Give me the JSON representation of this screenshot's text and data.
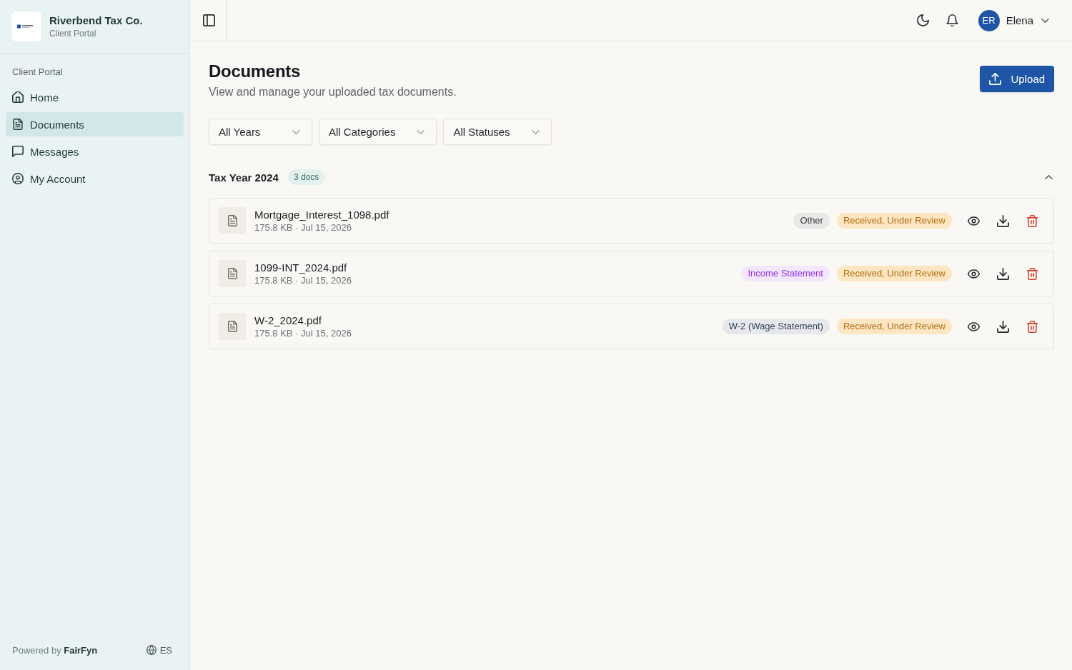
{
  "sidebar": {
    "brand": {
      "name": "Riverbend Tax Co.",
      "subtitle": "Client Portal"
    },
    "section_label": "Client Portal",
    "items": [
      {
        "label": "Home",
        "selected": false
      },
      {
        "label": "Documents",
        "selected": true
      },
      {
        "label": "Messages",
        "selected": false
      },
      {
        "label": "My Account",
        "selected": false
      }
    ],
    "footer": {
      "powered_by": "Powered by **FairFyn**",
      "language": "ES"
    }
  },
  "top_bar": {
    "user": {
      "initials": "ER",
      "name": "Elena"
    }
  },
  "page": {
    "title": "Documents",
    "subtitle": "View and manage your uploaded tax documents.",
    "upload_button": "Upload"
  },
  "filters": [
    "All Years",
    "All Categories",
    "All Statuses"
  ],
  "groups": [
    {
      "title": "Tax Year 2024",
      "count": "3 docs",
      "expanded": true,
      "documents": [
        {
          "name": "Mortgage_Interest_1098.pdf",
          "meta": "175.8 KB · Jul 15, 2026",
          "category": {
            "label": "Other",
            "color": "#3f3f46"
          },
          "status": "Received, Under Review"
        },
        {
          "name": "1099-INT_2024.pdf",
          "meta": "175.8 KB · Jul 15, 2026",
          "category": {
            "label": "Income Statement",
            "color": "#9333ea"
          },
          "status": "Received, Under Review"
        },
        {
          "name": "W-2_2024.pdf",
          "meta": "175.8 KB · Jul 15, 2026",
          "category": {
            "label": "W-2 (Wage Statement)",
            "color": "#334155"
          },
          "status": "Received, Under Review"
        }
      ]
    }
  ]
}
